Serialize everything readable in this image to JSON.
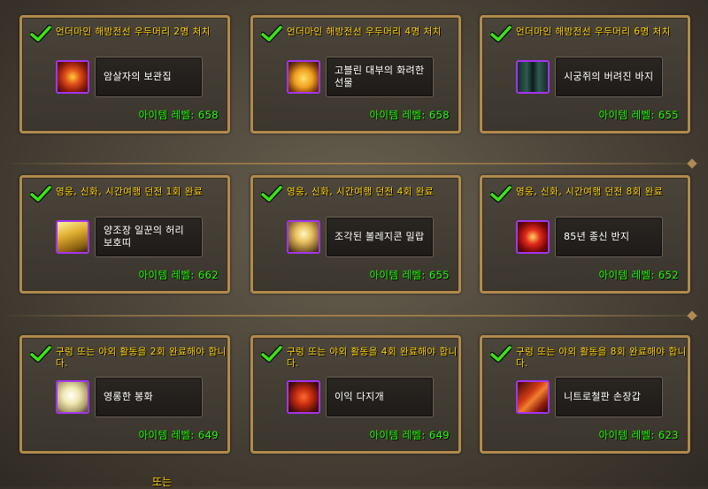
{
  "rows": [
    {
      "cards": [
        {
          "condition": "언더마인 해방전선 우두머리 2명 처치",
          "item": "암살자의 보관집",
          "ilvl": "아이템 레벨: 658",
          "icon": "ic1"
        },
        {
          "condition": "언더마인 해방전선 우두머리 4명 처치",
          "item": "고블린 대부의 화려한 선물",
          "ilvl": "아이템 레벨: 658",
          "icon": "ic2"
        },
        {
          "condition": "언더마인 해방전선 우두머리 6명 처치",
          "item": "시궁쥐의 버려진 바지",
          "ilvl": "아이템 레벨: 655",
          "icon": "ic3"
        }
      ]
    },
    {
      "cards": [
        {
          "condition": "영웅, 신화, 시간여행 던전 1회 완료",
          "item": "양조장 일꾼의 허리 보호띠",
          "ilvl": "아이템 레벨: 662",
          "icon": "ic4"
        },
        {
          "condition": "영웅, 신화, 시간여행 던전 4회 완료",
          "item": "조각된 볼레지콘 밀랍",
          "ilvl": "아이템 레벨: 655",
          "icon": "ic5"
        },
        {
          "condition": "영웅, 신화, 시간여행 던전 8회 완료",
          "item": "85년 종신 반지",
          "ilvl": "아이템 레벨: 652",
          "icon": "ic6"
        }
      ]
    },
    {
      "cards": [
        {
          "condition": "구렁 또는 야외 활동을 2회 완료해야 합니다.",
          "item": "영롱한 봉화",
          "ilvl": "아이템 레벨: 649",
          "icon": "ic7"
        },
        {
          "condition": "구렁 또는 야외 활동을 4회 완료해야 합니다.",
          "item": "이익 다지개",
          "ilvl": "아이템 레벨: 649",
          "icon": "ic8"
        },
        {
          "condition": "구렁 또는 야외 활동을 8회 완료해야 합니다.",
          "item": "니트로철판 손장갑",
          "ilvl": "아이템 레벨: 623",
          "icon": "ic9"
        }
      ]
    }
  ],
  "footer": {
    "or_text": "또는"
  },
  "colors": {
    "condition": "#ffd100",
    "ilvl": "#1eff00",
    "item_border": "#a335ee",
    "card_border": "#b08a4d"
  },
  "icons": {
    "check": "checkmark-icon"
  }
}
